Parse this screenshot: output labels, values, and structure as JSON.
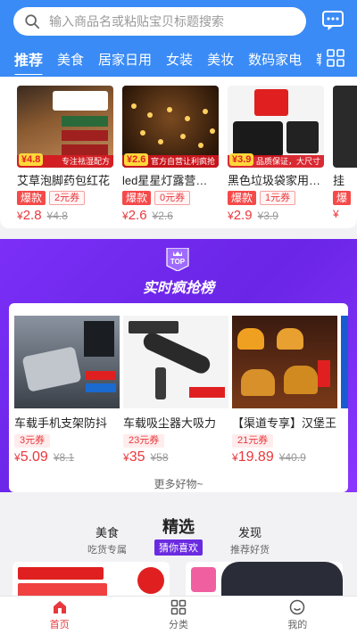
{
  "search": {
    "placeholder": "输入商品名或粘贴宝贝标题搜索"
  },
  "icons": {
    "search": "search-icon",
    "message": "message-icon",
    "grid": "grid-icon",
    "top": "top-badge-icon"
  },
  "tabs": [
    "推荐",
    "美食",
    "居家日用",
    "女装",
    "美妆",
    "数码家电",
    "鞋"
  ],
  "products": [
    {
      "title": "艾草泡脚药包红花",
      "hot": "爆款",
      "coupon": "2元券",
      "yen": "¥",
      "price": "2.8",
      "orig": "¥4.8",
      "badge": "¥4.8",
      "tag": "专注祛湿配方"
    },
    {
      "title": "led星星灯露营氛围",
      "hot": "爆款",
      "coupon": "0元券",
      "yen": "¥",
      "price": "2.6",
      "orig": "¥2.6",
      "badge": "¥2.6",
      "tag": "官方自营让利疯抢"
    },
    {
      "title": "黑色垃圾袋家用加厚",
      "hot": "爆款",
      "coupon": "1元券",
      "yen": "¥",
      "price": "2.9",
      "orig": "¥3.9",
      "badge": "¥3.9",
      "tag": "品质保证，大尺寸"
    },
    {
      "title": "挂",
      "hot": "爆",
      "coupon": "",
      "yen": "¥",
      "price": "",
      "orig": "",
      "badge": "",
      "tag": ""
    }
  ],
  "ranking": {
    "title": "实时疯抢榜",
    "top_label": "TOP",
    "more": "更多好物~",
    "items": [
      {
        "title": "车载手机支架防抖",
        "coupon": "3元券",
        "yen": "¥",
        "price": "5.09",
        "orig": "¥8.1"
      },
      {
        "title": "车载吸尘器大吸力",
        "coupon": "23元券",
        "yen": "¥",
        "price": "35",
        "orig": "¥58"
      },
      {
        "title": "【渠道专享】汉堡王",
        "coupon": "21元券",
        "yen": "¥",
        "price": "19.89",
        "orig": "¥40.9"
      }
    ]
  },
  "channels": [
    {
      "title": "美食",
      "sub": "吃货专属"
    },
    {
      "title": "精选",
      "sub": "猜你喜欢"
    },
    {
      "title": "发现",
      "sub": "推荐好货"
    }
  ],
  "bottom_nav": [
    {
      "label": "首页",
      "icon": "home-icon",
      "active": true
    },
    {
      "label": "分类",
      "icon": "category-icon",
      "active": false
    },
    {
      "label": "我的",
      "icon": "profile-icon",
      "active": false
    }
  ],
  "colors": {
    "header": "#3a8bf5",
    "rank_bg": "#7b2ff7",
    "accent_red": "#e8383d"
  }
}
